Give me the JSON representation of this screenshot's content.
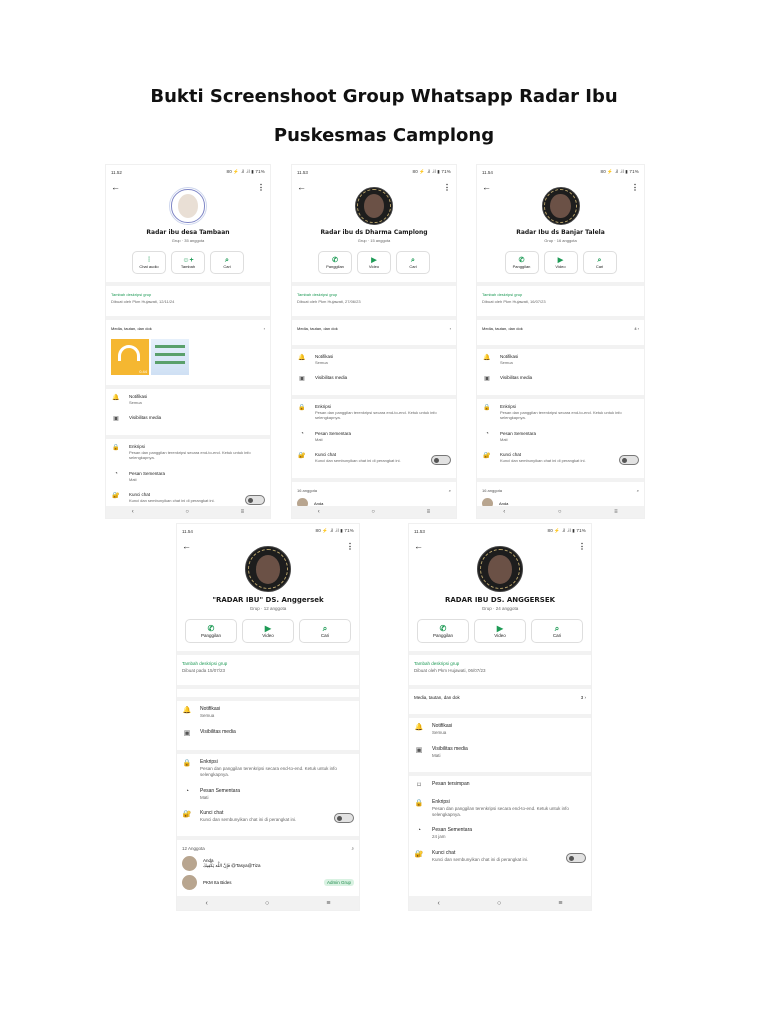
{
  "doc": {
    "title_line1": "Bukti Screenshoot Group Whatsapp Radar Ibu",
    "title_line2": "Puskesmas Camplong"
  },
  "screens": [
    {
      "time": "11.52",
      "status_right": "80 ⚡ .il .il ▮ 71%",
      "group_name": "Radar ibu desa Tambaan",
      "group_sub": "Grup · 35 anggota",
      "avatar_style": "light",
      "actions": [
        {
          "icon": "audio-call-icon",
          "glyph": "⫶",
          "label": "Chat audio"
        },
        {
          "icon": "add-member-icon",
          "glyph": "☺+",
          "label": "Tambah"
        },
        {
          "icon": "search-icon",
          "glyph": "⌕",
          "label": "Cari"
        }
      ],
      "desc_add": "Tambah deskripsi grup",
      "desc_by": "Dibuat oleh Pkm Hujawati, 12/11/24",
      "media_label": "Media, tautan, dan dok",
      "media_count": "",
      "has_thumbs": true,
      "thumb_duration": "0.44",
      "rows": [
        {
          "icon": "bell-icon",
          "glyph": "🔔",
          "title": "Notifikasi",
          "sub": "Semua"
        },
        {
          "icon": "media-visibility-icon",
          "glyph": "▣",
          "title": "Visibilitas media",
          "sub": ""
        },
        {
          "icon": "lock-icon",
          "glyph": "🔒",
          "title": "Enkripsi",
          "sub": "Pesan dan panggilan terenkripsi secara end-to-end. Ketuk untuk info selengkapnya."
        },
        {
          "icon": "timer-icon",
          "glyph": "◔",
          "title": "Pesan Sementara",
          "sub": "Mati"
        },
        {
          "icon": "chat-lock-icon",
          "glyph": "🔐",
          "title": "Kunci chat",
          "sub": "Kunci dan sembunyikan chat ini di perangkat ini.",
          "toggle": true
        }
      ],
      "members_label": "",
      "members": []
    },
    {
      "time": "11.53",
      "status_right": "80 ⚡ .il .il ▮ 71%",
      "group_name": "Radar ibu ds Dharma Camplong",
      "group_sub": "Grup · 15 anggota",
      "avatar_style": "dark",
      "actions": [
        {
          "icon": "phone-icon",
          "glyph": "✆",
          "label": "Panggilan"
        },
        {
          "icon": "video-icon",
          "glyph": "▶",
          "label": "Video"
        },
        {
          "icon": "search-icon",
          "glyph": "⌕",
          "label": "Cari"
        }
      ],
      "desc_add": "Tambah deskripsi grup",
      "desc_by": "Dibuat oleh Pkm Hujawati, 27/06/23",
      "media_label": "Media, tautan, dan dok",
      "media_count": "",
      "has_thumbs": false,
      "rows": [
        {
          "icon": "bell-icon",
          "glyph": "🔔",
          "title": "Notifikasi",
          "sub": "Semua"
        },
        {
          "icon": "media-visibility-icon",
          "glyph": "▣",
          "title": "Visibilitas media",
          "sub": ""
        },
        {
          "icon": "lock-icon",
          "glyph": "🔒",
          "title": "Enkripsi",
          "sub": "Pesan dan panggilan terenkripsi secara end-to-end. Ketuk untuk info selengkapnya."
        },
        {
          "icon": "timer-icon",
          "glyph": "◔",
          "title": "Pesan Sementara",
          "sub": "Mati"
        },
        {
          "icon": "chat-lock-icon",
          "glyph": "🔐",
          "title": "Kunci chat",
          "sub": "Kunci dan sembunyikan chat ini di perangkat ini.",
          "toggle": true
        }
      ],
      "members_label": "16 anggota",
      "members": [
        {
          "name": "Anda",
          "sub": "",
          "badge": ""
        }
      ]
    },
    {
      "time": "11.54",
      "status_right": "80 ⚡ .il .il ▮ 71%",
      "group_name": "Radar Ibu ds Banjar Talela",
      "group_sub": "Grup · 16 anggota",
      "avatar_style": "dark",
      "actions": [
        {
          "icon": "phone-icon",
          "glyph": "✆",
          "label": "Panggilan"
        },
        {
          "icon": "video-icon",
          "glyph": "▶",
          "label": "Video"
        },
        {
          "icon": "search-icon",
          "glyph": "⌕",
          "label": "Cari"
        }
      ],
      "desc_add": "Tambah deskripsi grup",
      "desc_by": "Dibuat oleh Pkm Hujawati, 16/07/23",
      "media_label": "Media, tautan, dan dok",
      "media_count": "4",
      "has_thumbs": false,
      "rows": [
        {
          "icon": "bell-icon",
          "glyph": "🔔",
          "title": "Notifikasi",
          "sub": "Semua"
        },
        {
          "icon": "media-visibility-icon",
          "glyph": "▣",
          "title": "Visibilitas media",
          "sub": ""
        },
        {
          "icon": "lock-icon",
          "glyph": "🔒",
          "title": "Enkripsi",
          "sub": "Pesan dan panggilan terenkripsi secara end-to-end. Ketuk untuk info selengkapnya."
        },
        {
          "icon": "timer-icon",
          "glyph": "◔",
          "title": "Pesan Sementara",
          "sub": "Mati"
        },
        {
          "icon": "chat-lock-icon",
          "glyph": "🔐",
          "title": "Kunci chat",
          "sub": "Kunci dan sembunyikan chat ini di perangkat ini.",
          "toggle": true
        }
      ],
      "members_label": "16 anggota",
      "members": [
        {
          "name": "Anda",
          "sub": "",
          "badge": ""
        }
      ]
    },
    {
      "time": "11.54",
      "status_right": "80 ⚡ .il .il ▮ 71%",
      "group_name": "\"RADAR IBU\" DS. Anggersek",
      "group_sub": "Grup · 12 anggota",
      "avatar_style": "dark",
      "actions": [
        {
          "icon": "phone-icon",
          "glyph": "✆",
          "label": "Panggilan"
        },
        {
          "icon": "video-icon",
          "glyph": "▶",
          "label": "Video"
        },
        {
          "icon": "search-icon",
          "glyph": "⌕",
          "label": "Cari"
        }
      ],
      "desc_add": "Tambah deskripsi grup",
      "desc_by": "Dibuat pada 15/07/23",
      "media_label": "",
      "media_count": "",
      "has_thumbs": false,
      "rows": [
        {
          "icon": "bell-icon",
          "glyph": "🔔",
          "title": "Notifikasi",
          "sub": "Semua"
        },
        {
          "icon": "media-visibility-icon",
          "glyph": "▣",
          "title": "Visibilitas media",
          "sub": ""
        },
        {
          "icon": "lock-icon",
          "glyph": "🔒",
          "title": "Enkripsi",
          "sub": "Pesan dan panggilan terenkripsi secara end-to-end. Ketuk untuk info selengkapnya."
        },
        {
          "icon": "timer-icon",
          "glyph": "◔",
          "title": "Pesan Sementara",
          "sub": "Mati"
        },
        {
          "icon": "chat-lock-icon",
          "glyph": "🔐",
          "title": "Kunci chat",
          "sub": "Kunci dan sembunyikan chat ini di perangkat ini.",
          "toggle": true
        }
      ],
      "members_label": "12 Anggota",
      "members": [
        {
          "name": "Anda",
          "sub": "فَإِنَّ اللَّهَ يَكْفِيكَ @Tasya@Tiza",
          "badge": ""
        },
        {
          "name": "PKM Ita Bides",
          "sub": "",
          "badge": "Admin Grup"
        }
      ]
    },
    {
      "time": "11.53",
      "status_right": "80 ⚡ .il .il ▮ 71%",
      "group_name": "RADAR IBU DS. ANGGERSEK",
      "group_sub": "Grup · 24 anggota",
      "avatar_style": "dark",
      "actions": [
        {
          "icon": "phone-icon",
          "glyph": "✆",
          "label": "Panggilan"
        },
        {
          "icon": "video-icon",
          "glyph": "▶",
          "label": "Video"
        },
        {
          "icon": "search-icon",
          "glyph": "⌕",
          "label": "Cari"
        }
      ],
      "desc_add": "Tambah deskripsi grup",
      "desc_by": "Dibuat oleh Pkm Hujawati, 06/07/23",
      "media_label": "Media, tautan, dan dok",
      "media_count": "3",
      "has_thumbs": false,
      "rows": [
        {
          "icon": "bell-icon",
          "glyph": "🔔",
          "title": "Notifikasi",
          "sub": "Semua"
        },
        {
          "icon": "media-visibility-icon",
          "glyph": "▣",
          "title": "Visibilitas media",
          "sub": "Mati"
        },
        {
          "icon": "bookmark-icon",
          "glyph": "⌑",
          "title": "Pesan tersimpan",
          "sub": ""
        },
        {
          "icon": "lock-icon",
          "glyph": "🔒",
          "title": "Enkripsi",
          "sub": "Pesan dan panggilan terenkripsi secara end-to-end. Ketuk untuk info selengkapnya."
        },
        {
          "icon": "timer-icon",
          "glyph": "◔",
          "title": "Pesan Sementara",
          "sub": "24 jam"
        },
        {
          "icon": "chat-lock-icon",
          "glyph": "🔐",
          "title": "Kunci chat",
          "sub": "Kunci dan sembunyikan chat ini di perangkat ini.",
          "toggle": true
        }
      ],
      "members_label": "",
      "members": []
    }
  ],
  "nav": {
    "back": "‹",
    "home": "○",
    "recents": "≡"
  },
  "colors": {
    "accent": "#1d9a55",
    "divider": "#f2f2f2"
  }
}
